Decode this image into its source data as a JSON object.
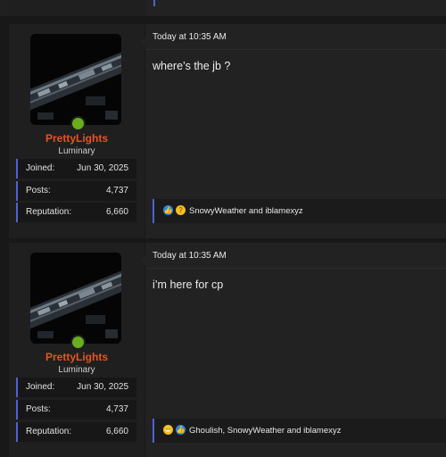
{
  "posts": [
    {
      "time": "Today at 10:35 AM",
      "message": "where’s the jb ?",
      "user": {
        "name": "PrettyLights",
        "title": "Luminary",
        "stats": {
          "joined_label": "Joined:",
          "joined_value": "Jun 30, 2025",
          "posts_label": "Posts:",
          "posts_value": "4,737",
          "rep_label": "Reputation:",
          "rep_value": "6,660"
        }
      },
      "reactions": {
        "icons": [
          "like-icon",
          "thinking-icon"
        ],
        "text": "SnowyWeather and iblamexyz"
      }
    },
    {
      "time": "Today at 10:35 AM",
      "message": "i’m here for cp",
      "user": {
        "name": "PrettyLights",
        "title": "Luminary",
        "stats": {
          "joined_label": "Joined:",
          "joined_value": "Jun 30, 2025",
          "posts_label": "Posts:",
          "posts_value": "4,737",
          "rep_label": "Reputation:",
          "rep_value": "6,660"
        }
      },
      "reactions": {
        "icons": [
          "grimacing-icon",
          "like-icon"
        ],
        "text": "Ghoulish, SnowyWeather and iblamexyz"
      }
    }
  ],
  "colors": {
    "accent": "#4f62d6",
    "username": "#e8541e",
    "online": "#6aad1d"
  }
}
